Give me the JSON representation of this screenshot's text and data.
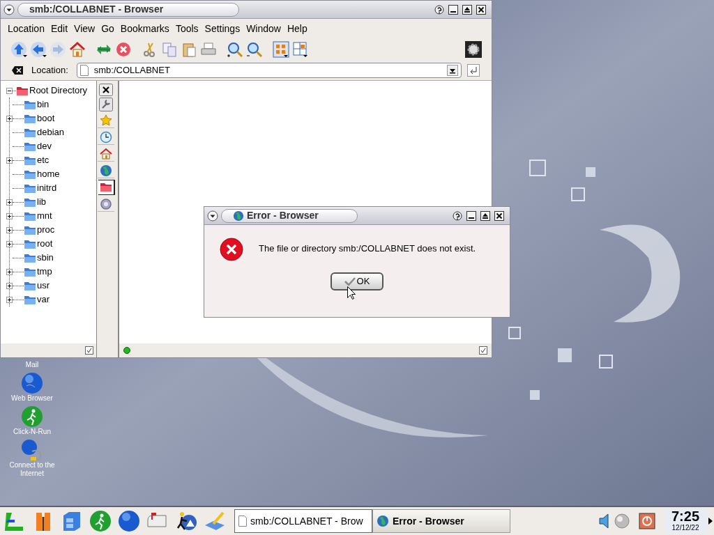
{
  "browser_window": {
    "title": "smb:/COLLABNET - Browser",
    "menu": [
      "Location",
      "Edit",
      "View",
      "Go",
      "Bookmarks",
      "Tools",
      "Settings",
      "Window",
      "Help"
    ],
    "location_label": "Location:",
    "location_value": "smb:/COLLABNET",
    "tree": {
      "label": "Root Directory",
      "expanded": true,
      "children": [
        {
          "label": "bin",
          "has_children": false
        },
        {
          "label": "boot",
          "has_children": true
        },
        {
          "label": "debian",
          "has_children": false
        },
        {
          "label": "dev",
          "has_children": false
        },
        {
          "label": "etc",
          "has_children": true
        },
        {
          "label": "home",
          "has_children": false
        },
        {
          "label": "initrd",
          "has_children": false
        },
        {
          "label": "lib",
          "has_children": true
        },
        {
          "label": "mnt",
          "has_children": true
        },
        {
          "label": "proc",
          "has_children": true
        },
        {
          "label": "root",
          "has_children": true
        },
        {
          "label": "sbin",
          "has_children": false
        },
        {
          "label": "tmp",
          "has_children": true
        },
        {
          "label": "usr",
          "has_children": true
        },
        {
          "label": "var",
          "has_children": true
        }
      ]
    },
    "side_tabs": [
      {
        "kind": "star",
        "selected": false
      },
      {
        "kind": "clock",
        "selected": false
      },
      {
        "kind": "home",
        "selected": false
      },
      {
        "kind": "globe",
        "selected": false
      },
      {
        "kind": "folder",
        "selected": true
      },
      {
        "kind": "gear",
        "selected": false
      }
    ]
  },
  "error_dialog": {
    "title": "Error - Browser",
    "message": "The file or directory smb:/COLLABNET does not exist.",
    "button": "OK"
  },
  "desktop_icons": [
    {
      "label": "Mail",
      "kind": "none"
    },
    {
      "label": "Web Browser",
      "kind": "globe"
    },
    {
      "label": "Click-N-Run",
      "kind": "runner"
    },
    {
      "label": "Connect to the Internet",
      "kind": "connect"
    }
  ],
  "taskbar": {
    "tasks": [
      {
        "label": "smb:/COLLABNET - Brow",
        "selected": false,
        "kind": "page"
      },
      {
        "label": "Error - Browser",
        "selected": true,
        "kind": "globe"
      }
    ],
    "clock": "7:25",
    "date": "12/12/22"
  }
}
